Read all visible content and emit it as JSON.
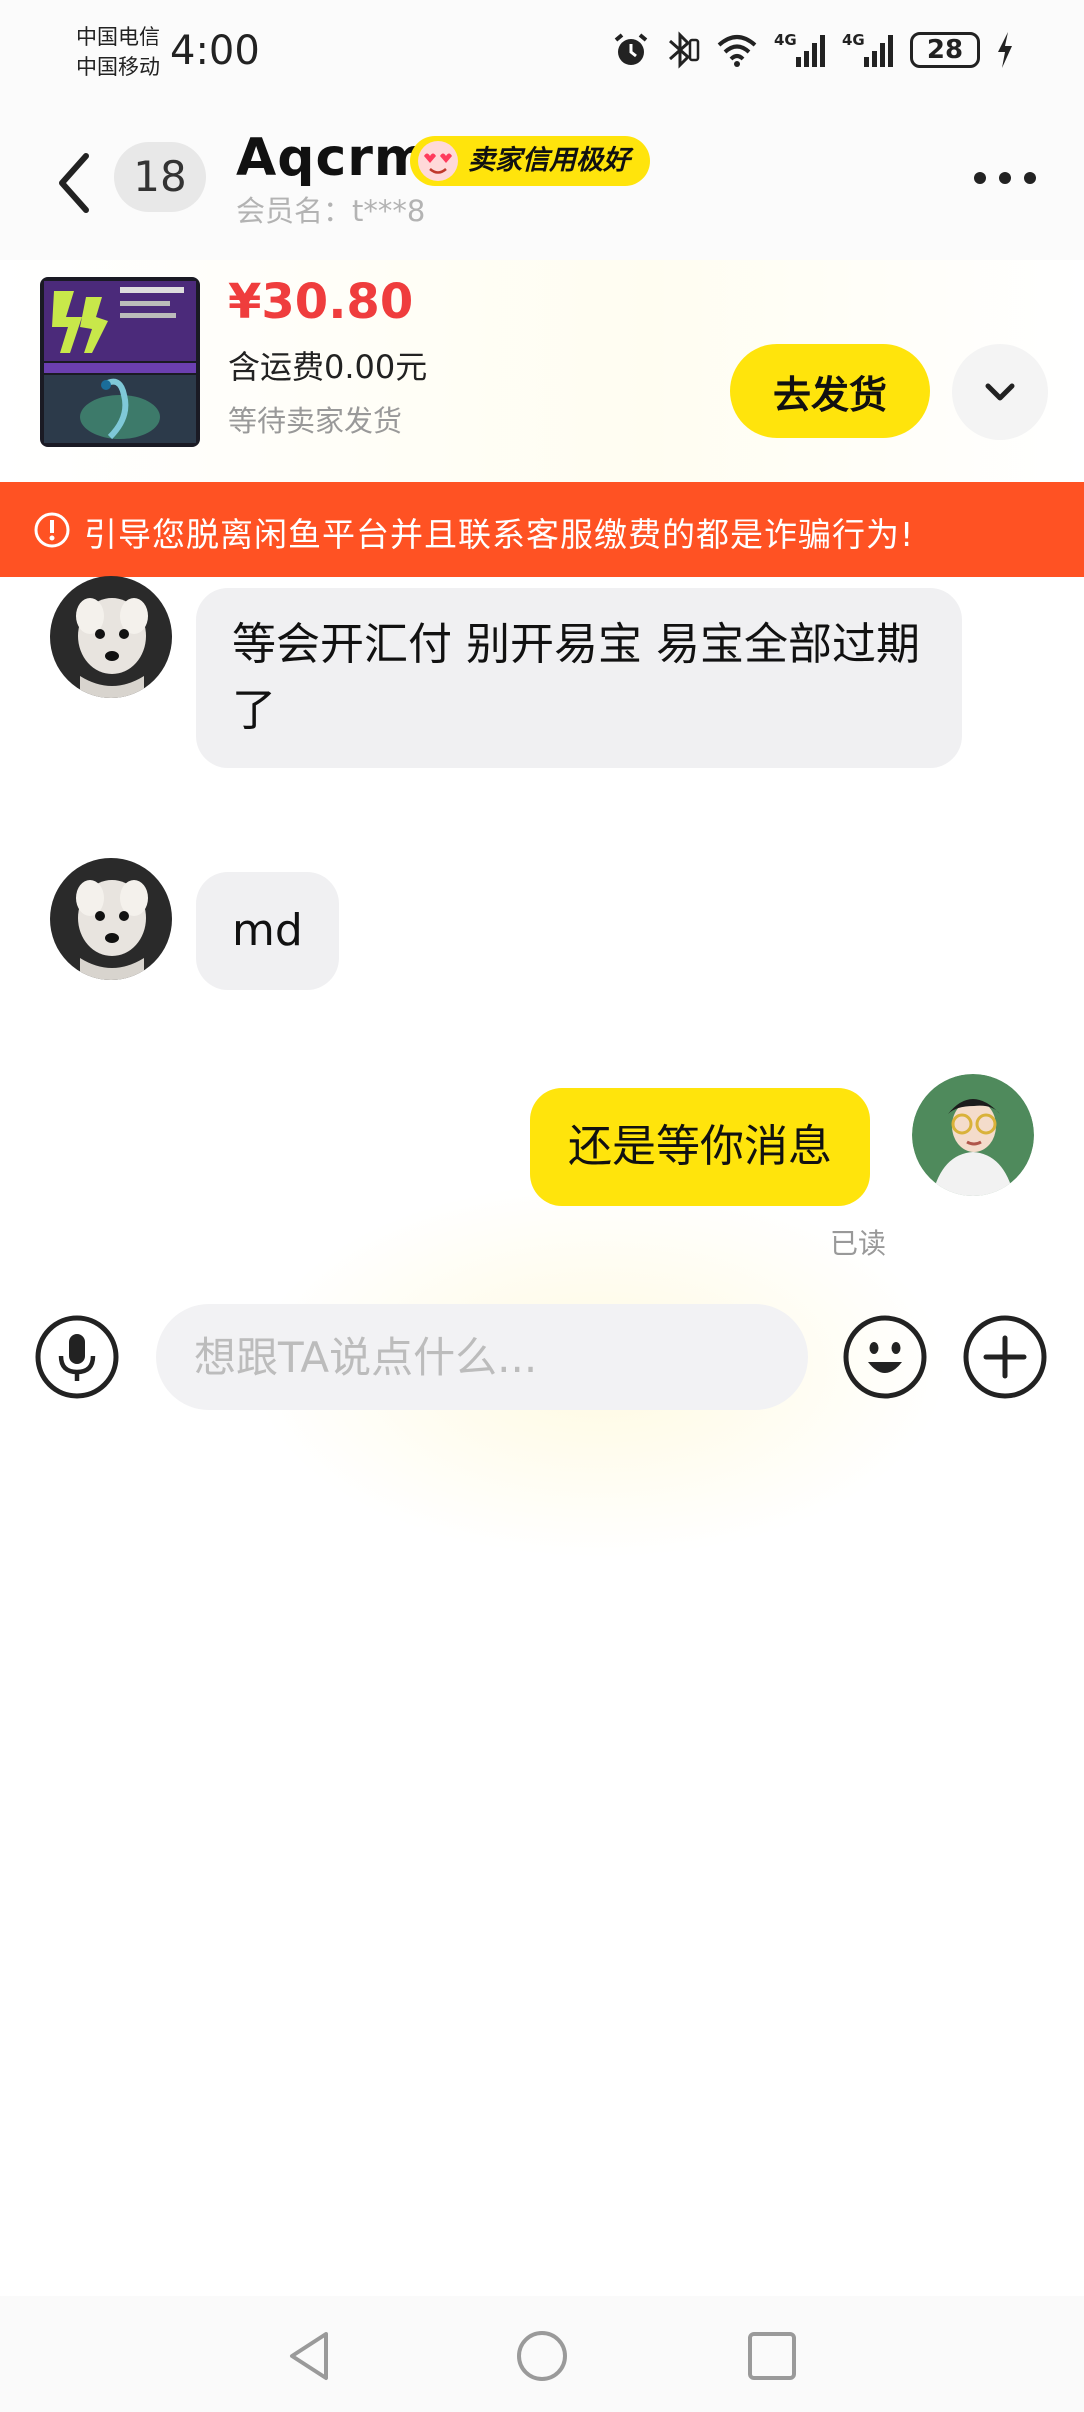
{
  "status_bar": {
    "carrier_1": "中国电信",
    "carrier_2": "中国移动",
    "time": "4:00",
    "network_1": "4G",
    "network_2": "4G",
    "battery": "28",
    "icons": [
      "alarm-icon",
      "bluetooth-icon",
      "wifi-icon",
      "signal-icon",
      "charging-icon"
    ]
  },
  "header": {
    "unread_count": "18",
    "user_name": "Aqcrm",
    "credit_badge": "卖家信用极好",
    "member_label": "会员名：t***8"
  },
  "order": {
    "price": "¥30.80",
    "shipping": "含运费0.00元",
    "status": "等待卖家发货",
    "ship_button": "去发货"
  },
  "warning": {
    "text": "引导您脱离闲鱼平台并且联系客服缴费的都是诈骗行为!"
  },
  "messages": [
    {
      "from": "other",
      "text": "等会开汇付 别开易宝 易宝全部过期了"
    },
    {
      "from": "other",
      "text": "md"
    },
    {
      "from": "me",
      "text": "还是等你消息",
      "status": "已读"
    }
  ],
  "input": {
    "placeholder": "想跟TA说点什么..."
  },
  "colors": {
    "accent_yellow": "#ffe40c",
    "price_red": "#ef3d3d",
    "warning_orange": "#ff5223",
    "bubble_gray": "#f0f0f2"
  }
}
